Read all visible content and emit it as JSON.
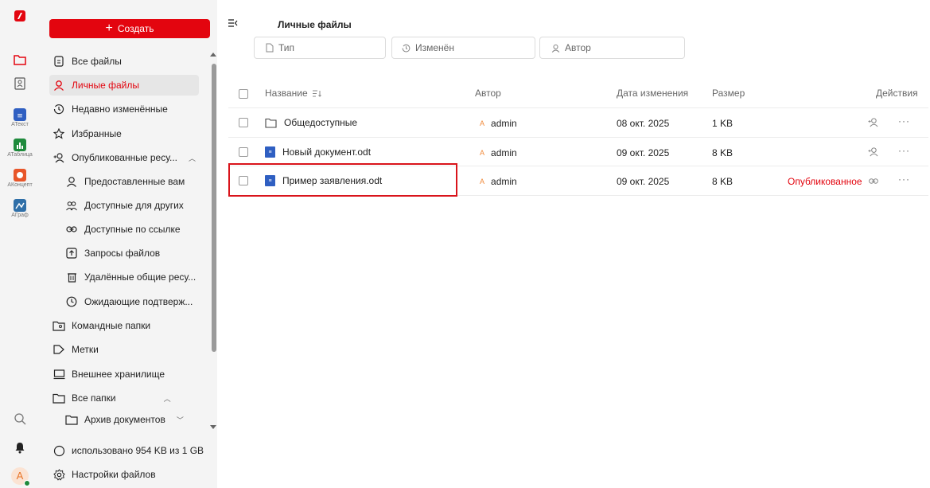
{
  "rail": {
    "items": [
      {
        "label": "",
        "icon": "app-logo-icon"
      },
      {
        "label": "",
        "icon": "folder-icon"
      },
      {
        "label": "",
        "icon": "contacts-icon"
      },
      {
        "label": "АТекст",
        "icon": "atekst-icon"
      },
      {
        "label": "АТаблица",
        "icon": "atablica-icon"
      },
      {
        "label": "АКонцепт",
        "icon": "akoncept-icon"
      },
      {
        "label": "АГраф",
        "icon": "agraf-icon"
      }
    ],
    "avatar_letter": "A"
  },
  "sidebar": {
    "create_label": "Создать",
    "items": [
      {
        "label": "Все файлы",
        "icon": "file-icon"
      },
      {
        "label": "Личные файлы",
        "icon": "user-icon"
      },
      {
        "label": "Недавно изменённые",
        "icon": "history-icon"
      },
      {
        "label": "Избранные",
        "icon": "star-icon"
      },
      {
        "label": "Опубликованные ресу...",
        "icon": "share-icon"
      },
      {
        "label": "Предоставленные вам",
        "icon": "user-icon"
      },
      {
        "label": "Доступные для других",
        "icon": "users-icon"
      },
      {
        "label": "Доступные по ссылке",
        "icon": "link-icon"
      },
      {
        "label": "Запросы файлов",
        "icon": "upload-request-icon"
      },
      {
        "label": "Удалённые общие ресу...",
        "icon": "trash-icon"
      },
      {
        "label": "Ожидающие подтверж...",
        "icon": "pending-icon"
      },
      {
        "label": "Командные папки",
        "icon": "team-folder-icon"
      },
      {
        "label": "Метки",
        "icon": "tag-icon"
      },
      {
        "label": "Внешнее хранилище",
        "icon": "external-storage-icon"
      },
      {
        "label": "Все папки",
        "icon": "folder-icon"
      },
      {
        "label": "Архив документов",
        "icon": "folder-icon"
      },
      {
        "label": "использовано 954 KB из 1 GB",
        "icon": "cloud-icon"
      },
      {
        "label": "Настройки файлов",
        "icon": "settings-icon"
      }
    ]
  },
  "main": {
    "title": "Личные файлы",
    "filters": {
      "type": "Тип",
      "modified": "Изменён",
      "author": "Автор"
    },
    "columns": {
      "name": "Название",
      "author": "Автор",
      "date": "Дата изменения",
      "size": "Размер",
      "actions": "Действия"
    },
    "rows": [
      {
        "name": "Общедоступные",
        "author": "admin",
        "date": "08 окт. 2025",
        "size": "1 KB",
        "status": ""
      },
      {
        "name": "Новый документ.odt",
        "author": "admin",
        "date": "09 окт. 2025",
        "size": "8 KB",
        "status": ""
      },
      {
        "name": "Пример заявления.odt",
        "author": "admin",
        "date": "09 окт. 2025",
        "size": "8 KB",
        "status": "Опубликованное"
      }
    ],
    "author_initial": "A"
  },
  "colors": {
    "accent": "#e3050f",
    "doc": "#2f5fc2"
  }
}
